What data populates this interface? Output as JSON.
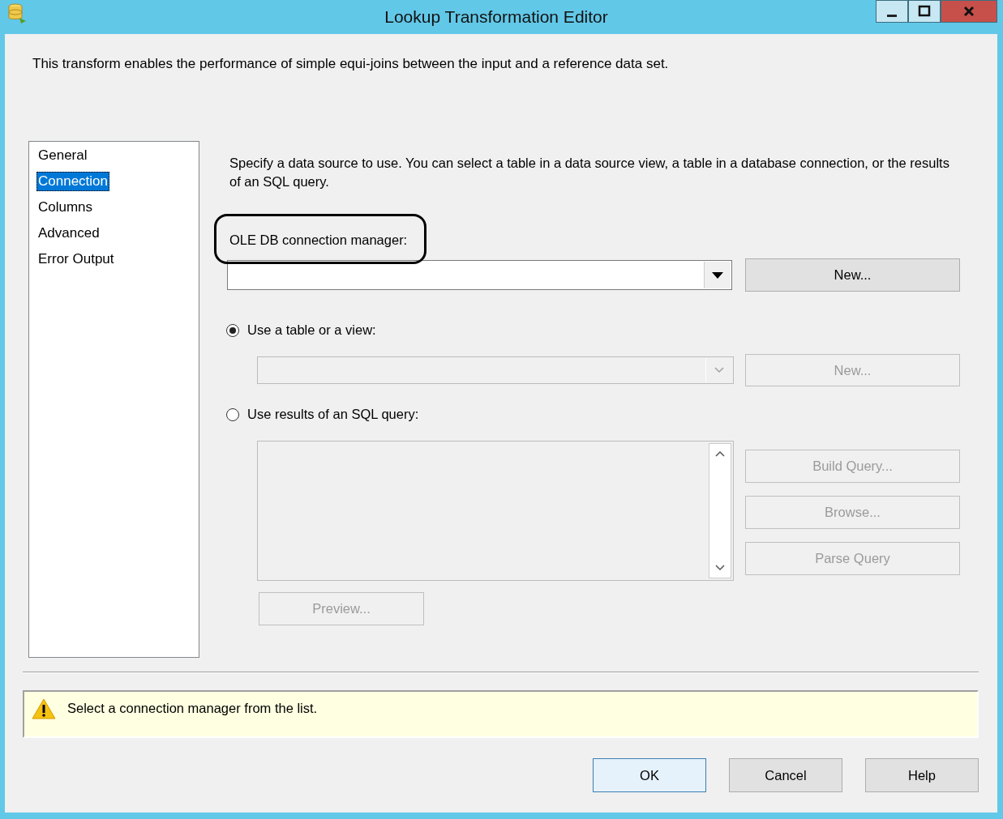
{
  "window": {
    "title": "Lookup Transformation Editor"
  },
  "description": "This transform enables the performance of simple equi-joins between the input and a reference data set.",
  "nav": [
    {
      "label": "General",
      "selected": false
    },
    {
      "label": "Connection",
      "selected": true
    },
    {
      "label": "Columns",
      "selected": false
    },
    {
      "label": "Advanced",
      "selected": false
    },
    {
      "label": "Error Output",
      "selected": false
    }
  ],
  "connection": {
    "instructions": "Specify a data source to use. You can select a table in a data source view, a table in a database connection, or the results of an SQL query.",
    "manager_label": "OLE DB connection manager:",
    "new_button": {
      "label": "New...",
      "disabled": false
    }
  },
  "options": [
    {
      "label": "Use a table or a view:",
      "selected": true
    },
    {
      "label": "Use results of an SQL query:",
      "selected": false
    }
  ],
  "table_select": {
    "disabled": true
  },
  "table_new_button": {
    "label": "New...",
    "disabled": true
  },
  "query_box": {
    "disabled": true
  },
  "query_buttons": [
    {
      "label": "Build Query...",
      "disabled": true
    },
    {
      "label": "Browse...",
      "disabled": true
    },
    {
      "label": "Parse Query",
      "disabled": true
    }
  ],
  "preview_button": {
    "label": "Preview...",
    "disabled": true
  },
  "message": {
    "kind": "warning",
    "text": "Select a connection manager from the list."
  },
  "buttons": [
    {
      "label": "OK",
      "default": true
    },
    {
      "label": "Cancel",
      "default": false
    },
    {
      "label": "Help",
      "default": false
    }
  ]
}
